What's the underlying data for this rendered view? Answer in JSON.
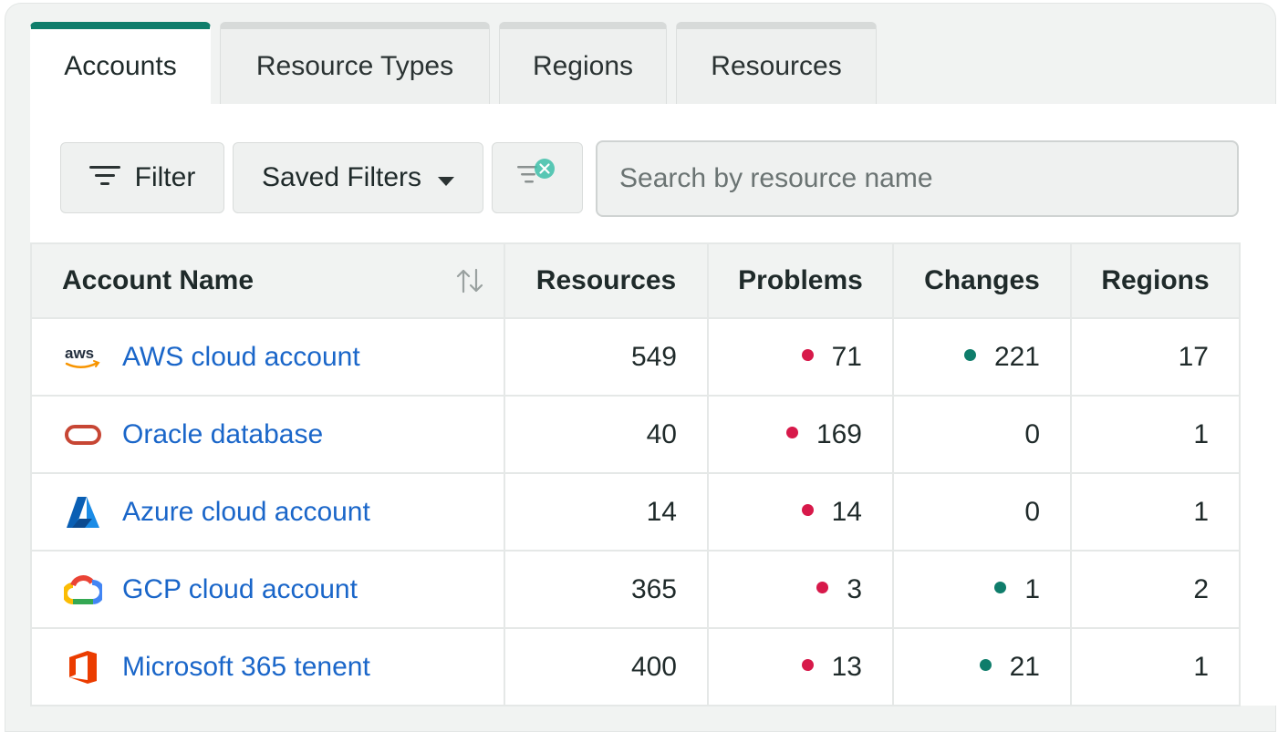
{
  "tabs": [
    {
      "label": "Accounts",
      "active": true
    },
    {
      "label": "Resource Types",
      "active": false
    },
    {
      "label": "Regions",
      "active": false
    },
    {
      "label": "Resources",
      "active": false
    }
  ],
  "toolbar": {
    "filter_label": "Filter",
    "saved_filters_label": "Saved Filters",
    "search_placeholder": "Search by resource name",
    "search_value": ""
  },
  "table": {
    "headers": [
      "Account Name",
      "Resources",
      "Problems",
      "Changes",
      "Regions"
    ],
    "rows": [
      {
        "icon": "aws-logo-icon",
        "name": "AWS cloud account",
        "resources": "549",
        "problems": "71",
        "changes": "221",
        "regions": "17"
      },
      {
        "icon": "oracle-logo-icon",
        "name": "Oracle database",
        "resources": "40",
        "problems": "169",
        "changes": "0",
        "regions": "1"
      },
      {
        "icon": "azure-logo-icon",
        "name": "Azure cloud account",
        "resources": "14",
        "problems": "14",
        "changes": "0",
        "regions": "1"
      },
      {
        "icon": "gcp-logo-icon",
        "name": "GCP cloud account",
        "resources": "365",
        "problems": "3",
        "changes": "1",
        "regions": "2"
      },
      {
        "icon": "microsoft-365-logo-icon",
        "name": "Microsoft 365 tenent",
        "resources": "400",
        "problems": "13",
        "changes": "21",
        "regions": "1"
      }
    ]
  },
  "colors": {
    "accent": "#0f7d6b",
    "link": "#1a66c9",
    "problem_dot": "#d7194a",
    "change_dot": "#0f7d6b"
  }
}
